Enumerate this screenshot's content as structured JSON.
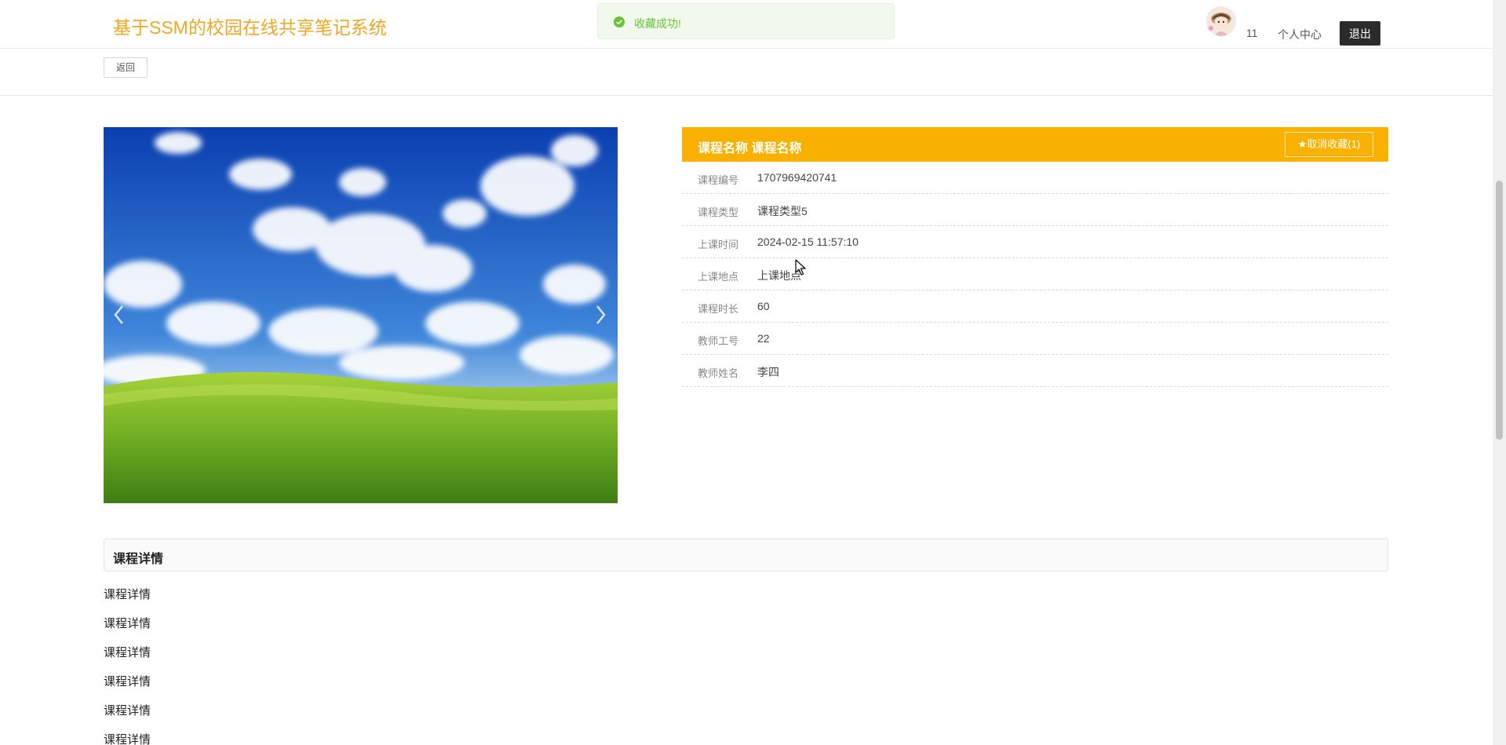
{
  "header": {
    "site_title": "基于SSM的校园在线共享笔记系统",
    "username": "11",
    "profile_label": "个人中心",
    "logout_label": "退出"
  },
  "toast": {
    "message": "收藏成功!",
    "color": "#67c23a"
  },
  "backbar": {
    "back_label": "返回"
  },
  "carousel": {
    "prev_icon": "chevron-left-icon",
    "next_icon": "chevron-right-icon"
  },
  "course": {
    "title": "课程名称 课程名称",
    "favorite_label": "★取消收藏(1)",
    "accent_color": "#f8b100",
    "fields": [
      {
        "label": "课程编号",
        "value": "1707969420741"
      },
      {
        "label": "课程类型",
        "value": "课程类型5"
      },
      {
        "label": "上课时间",
        "value": "2024-02-15 11:57:10"
      },
      {
        "label": "上课地点",
        "value": "上课地点"
      },
      {
        "label": "课程时长",
        "value": "60"
      },
      {
        "label": "教师工号",
        "value": "22"
      },
      {
        "label": "教师姓名",
        "value": "李四"
      }
    ]
  },
  "details": {
    "heading": "课程详情",
    "lines": [
      "课程详情",
      "课程详情",
      "课程详情",
      "课程详情",
      "课程详情",
      "课程详情"
    ]
  }
}
